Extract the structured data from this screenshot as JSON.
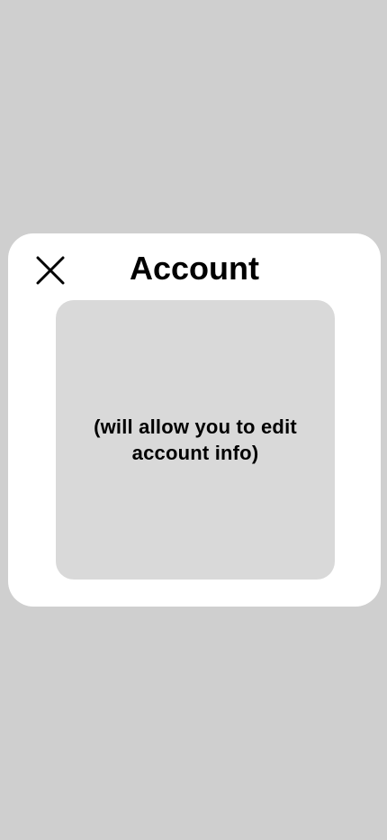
{
  "modal": {
    "title": "Account",
    "close_icon": "close-icon",
    "placeholder_text": "(will allow you to edit account info)"
  },
  "colors": {
    "background": "#cfcfcf",
    "modal": "#ffffff",
    "content_box": "#d9d9d9",
    "text": "#000000"
  }
}
